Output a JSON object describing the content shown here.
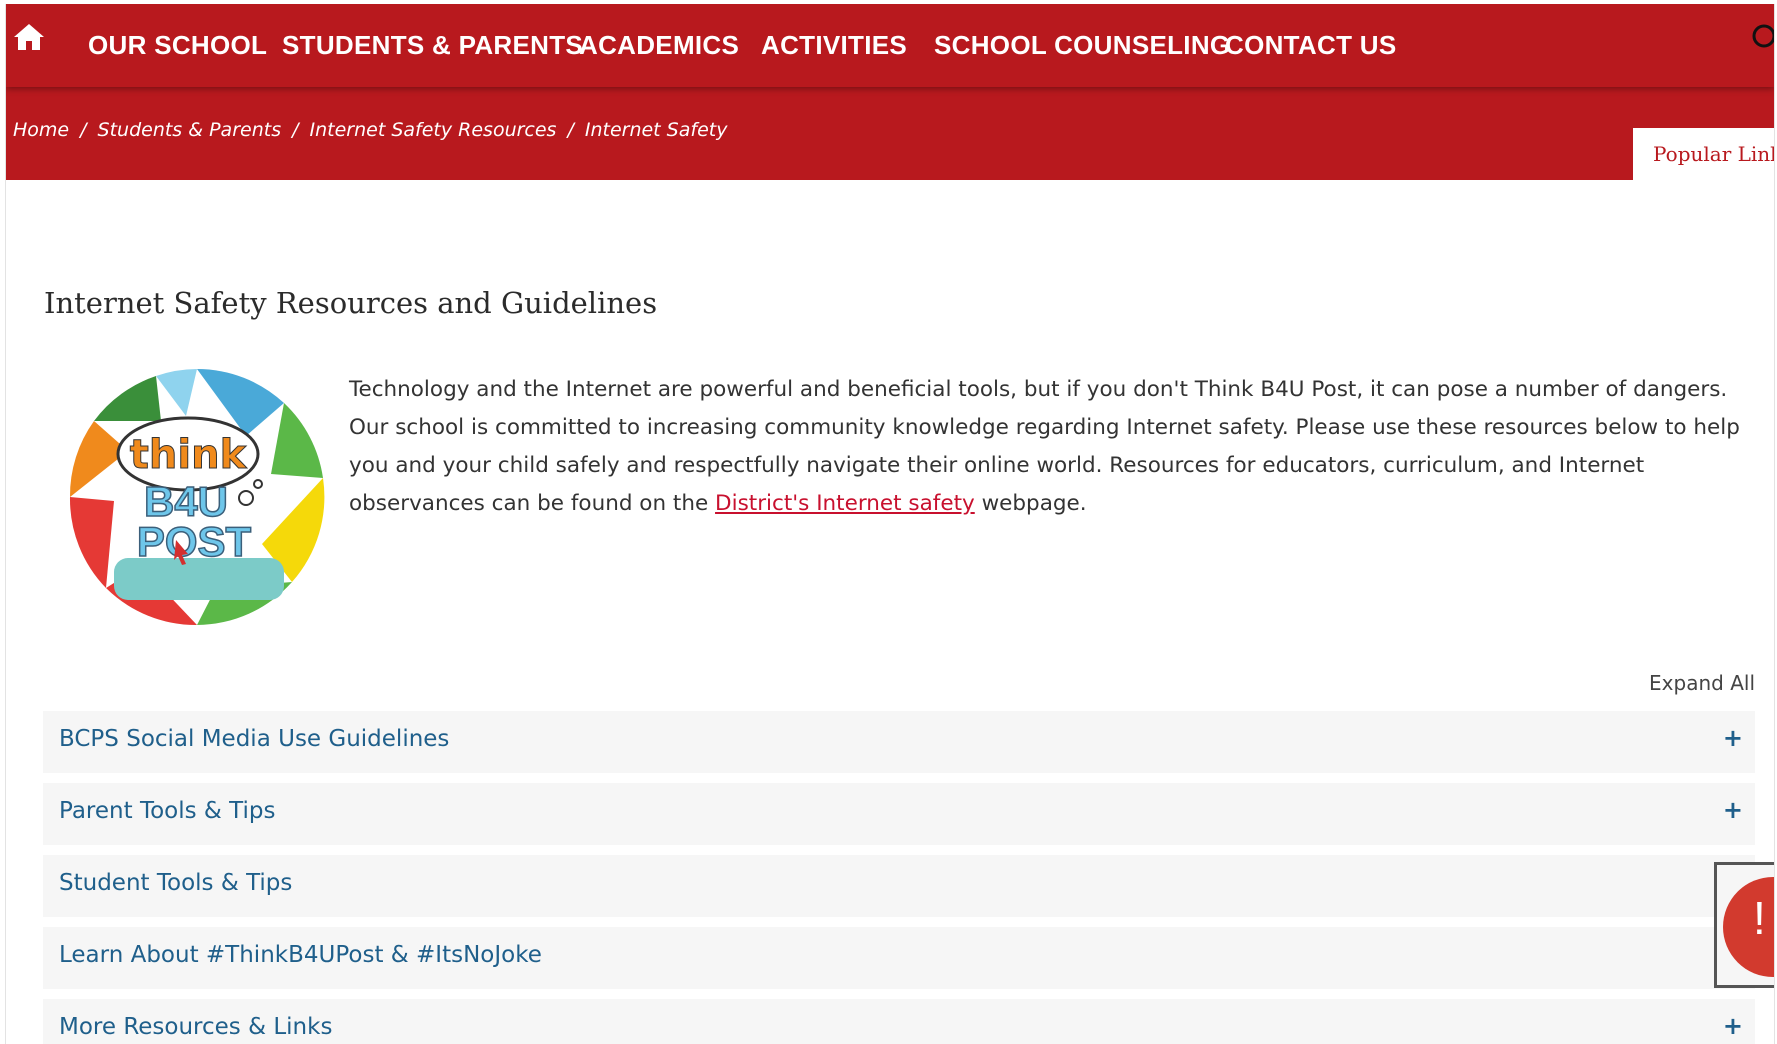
{
  "nav": {
    "home_icon": "home-icon",
    "search_icon": "search-icon",
    "items": [
      {
        "label": "OUR SCHOOL"
      },
      {
        "label": "STUDENTS & PARENTS"
      },
      {
        "label": "ACADEMICS"
      },
      {
        "label": "ACTIVITIES"
      },
      {
        "label": "SCHOOL COUNSELING"
      },
      {
        "label": "CONTACT US"
      }
    ]
  },
  "breadcrumb": {
    "separator": "/",
    "items": [
      "Home",
      "Students & Parents",
      "Internet Safety Resources",
      "Internet Safety"
    ]
  },
  "popular_links_tab": "Popular Link",
  "page_title": "Internet Safety Resources and Guidelines",
  "logo": {
    "word_top": "think",
    "word_middle": "B4U",
    "word_bottom": "POST"
  },
  "intro": {
    "text_before": "Technology and the Internet are powerful and beneficial tools, but if you don't Think B4U Post, it can pose a number of dangers. Our school is committed to increasing community knowledge regarding Internet safety. Please use these resources below to help you and your child safely and respectfully navigate their online world. Resources for educators, curriculum, and Internet observances can be found on the ",
    "link_text": "District's Internet safety",
    "text_after": " webpage."
  },
  "expand_all": "Expand All",
  "accordion": [
    {
      "label": "BCPS Social Media Use Guidelines",
      "toggle": "+"
    },
    {
      "label": "Parent Tools & Tips",
      "toggle": "+"
    },
    {
      "label": "Student Tools & Tips",
      "toggle": "+"
    },
    {
      "label": "Learn About #ThinkB4UPost & #ItsNoJoke",
      "toggle": "+"
    },
    {
      "label": "More Resources & Links",
      "toggle": "+"
    }
  ],
  "feedback_button": {
    "mark": "!"
  },
  "colors": {
    "brand_red": "#b8191e",
    "link_blue": "#1f5f8b",
    "link_red": "#c8102e"
  }
}
